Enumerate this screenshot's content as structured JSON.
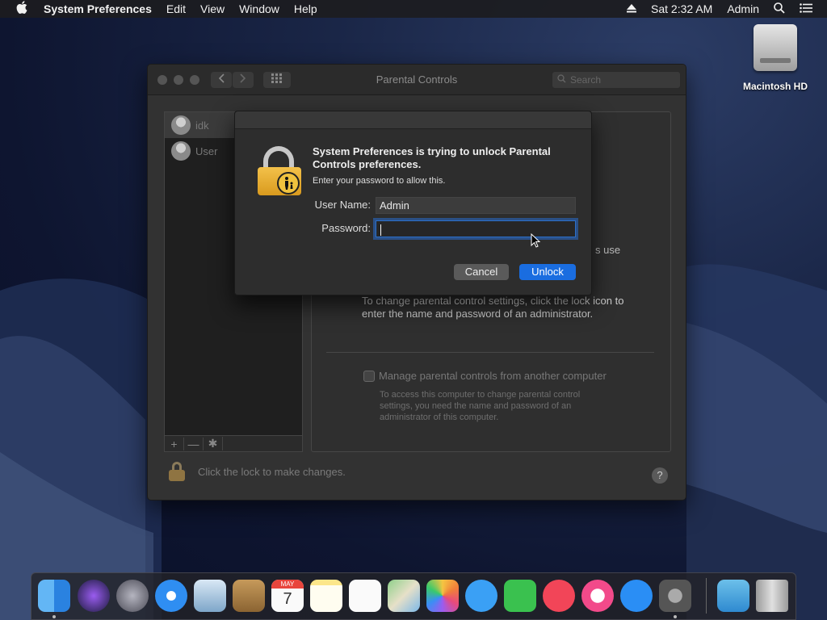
{
  "menubar": {
    "app_name": "System Preferences",
    "menus": [
      "Edit",
      "View",
      "Window",
      "Help"
    ],
    "clock": "Sat 2:32 AM",
    "user": "Admin"
  },
  "desktop": {
    "drive_label": "Macintosh HD"
  },
  "window": {
    "title": "Parental Controls",
    "search_placeholder": "Search",
    "users": [
      "idk",
      "User"
    ],
    "list_toolbar": {
      "add": "+",
      "remove": "—",
      "gear": "✱"
    },
    "partial_text": "s use",
    "info_text": "To change parental control settings, click the lock icon to enter the name and password of an administrator.",
    "manage_label": "Manage parental controls from another computer",
    "manage_sub": "To access this computer to change parental control settings, you need the name and password of an administrator of this computer.",
    "lock_text": "Click the lock to make changes.",
    "help": "?"
  },
  "dialog": {
    "title": "System Preferences is trying to unlock Parental Controls preferences.",
    "subtitle": "Enter your password to allow this.",
    "username_label": "User Name:",
    "username_value": "Admin",
    "password_label": "Password:",
    "password_value": "",
    "cancel_label": "Cancel",
    "unlock_label": "Unlock"
  },
  "dock": {
    "apps": [
      "Finder",
      "Siri",
      "Launchpad",
      "Safari",
      "Mail",
      "Contacts",
      "Calendar",
      "Notes",
      "Reminders",
      "Maps",
      "Photos",
      "Messages",
      "FaceTime",
      "News",
      "iTunes",
      "App Store",
      "System Preferences",
      "Downloads",
      "Trash"
    ],
    "calendar_month": "MAY",
    "calendar_day": "7"
  }
}
